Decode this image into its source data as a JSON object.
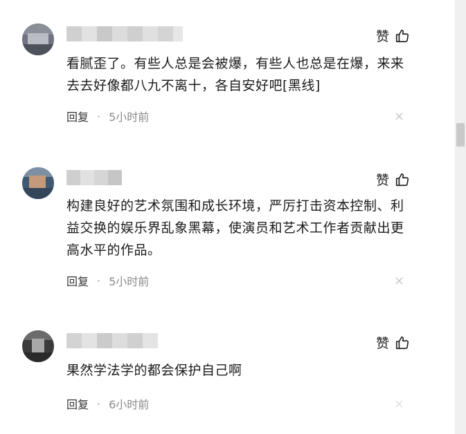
{
  "comments": [
    {
      "text": "看腻歪了。有些人总是会被爆，有些人也总是在爆，来来去去好像都八九不离十，各自安好吧[黑线]",
      "like_label": "赞",
      "reply_label": "回复",
      "separator": "·",
      "time": "5小时前",
      "close_glyph": "×"
    },
    {
      "text": "构建良好的艺术氛围和成长环境，严厉打击资本控制、利益交换的娱乐界乱象黑幕，使演员和艺术工作者贡献出更高水平的作品。",
      "like_label": "赞",
      "reply_label": "回复",
      "separator": "·",
      "time": "5小时前",
      "close_glyph": "×"
    },
    {
      "text": "果然学法学的都会保护自己啊",
      "like_label": "赞",
      "reply_label": "回复",
      "separator": "·",
      "time": "6小时前",
      "close_glyph": "×"
    }
  ],
  "colors": {
    "text": "#1a1a1a",
    "meta": "#8a8a8a",
    "scrollbar_track": "#f0f0f0",
    "scrollbar_thumb": "#c9c9c9"
  },
  "icons": {
    "like": "thumbs-up-icon",
    "close": "close-icon"
  }
}
